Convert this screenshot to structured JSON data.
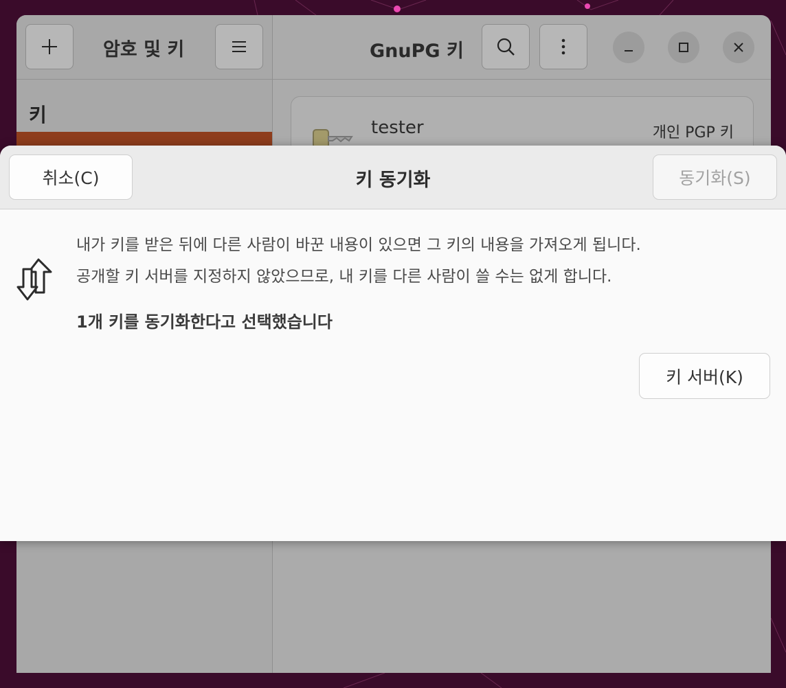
{
  "app": {
    "sidebar_title": "암호 및 키",
    "main_title": "GnuPG 키",
    "sidebar_section_label": "키",
    "key_item": {
      "name": "tester",
      "type": "개인 PGP 키"
    }
  },
  "dialog": {
    "title": "키 동기화",
    "cancel_label": "취소(C)",
    "sync_label": "동기화(S)",
    "description_line1": "내가 키를 받은 뒤에 다른 사람이 바꾼 내용이 있으면 그 키의 내용을 가져오게 됩니다.",
    "description_line2": "공개할 키 서버를 지정하지 않았으므로, 내 키를 다른 사람이 쓸 수는 없게 합니다.",
    "selected_count_text": "1개 키를 동기화한다고 선택했습니다",
    "key_servers_label": "키 서버(K)"
  },
  "icons": {
    "add": "plus-icon",
    "menu": "hamburger-menu-icon",
    "search": "search-icon",
    "more": "vertical-dots-icon",
    "minimize": "minimize-icon",
    "maximize": "maximize-icon",
    "close": "close-icon",
    "sync": "sync-arrows-icon",
    "key": "key-icon"
  },
  "colors": {
    "selection_accent": "#8e3d1c",
    "desktop_background": "#3a0b2a"
  }
}
